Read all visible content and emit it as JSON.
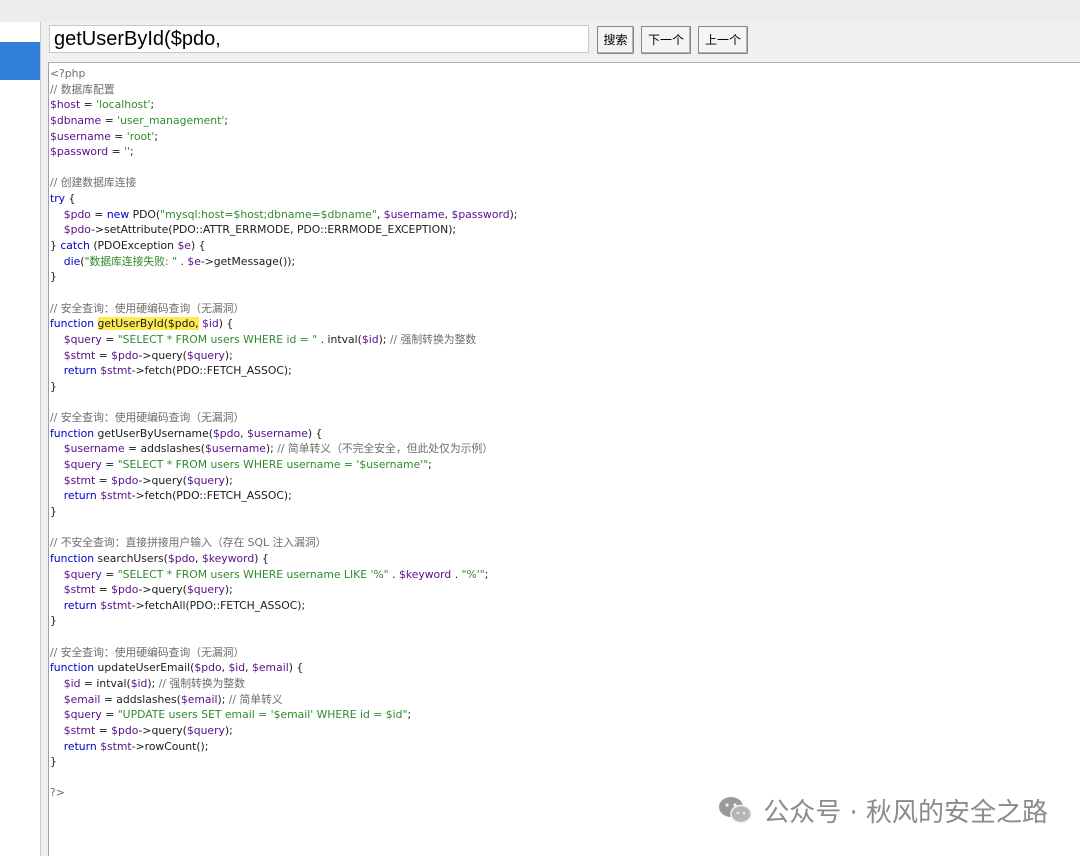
{
  "search": {
    "value": "getUserById($pdo,",
    "buttons": {
      "search": "搜索",
      "next": "下一个",
      "prev": "上一个"
    }
  },
  "code": {
    "lines": [
      [
        {
          "t": "<?php",
          "c": "cm"
        }
      ],
      [
        {
          "t": "// 数据库配置",
          "c": "cm"
        }
      ],
      [
        {
          "t": "$host",
          "c": "var"
        },
        {
          "t": " = "
        },
        {
          "t": "'localhost'",
          "c": "str"
        },
        {
          "t": ";"
        }
      ],
      [
        {
          "t": "$dbname",
          "c": "var"
        },
        {
          "t": " = "
        },
        {
          "t": "'user_management'",
          "c": "str"
        },
        {
          "t": ";"
        }
      ],
      [
        {
          "t": "$username",
          "c": "var"
        },
        {
          "t": " = "
        },
        {
          "t": "'root'",
          "c": "str"
        },
        {
          "t": ";"
        }
      ],
      [
        {
          "t": "$password",
          "c": "var"
        },
        {
          "t": " = "
        },
        {
          "t": "''",
          "c": "str"
        },
        {
          "t": ";"
        }
      ],
      [],
      [
        {
          "t": "// 创建数据库连接",
          "c": "cm"
        }
      ],
      [
        {
          "t": "try",
          "c": "kw"
        },
        {
          "t": " {"
        }
      ],
      [
        {
          "t": "    "
        },
        {
          "t": "$pdo",
          "c": "var"
        },
        {
          "t": " = "
        },
        {
          "t": "new",
          "c": "kw"
        },
        {
          "t": " PDO("
        },
        {
          "t": "\"mysql:host=$host;dbname=$dbname\"",
          "c": "str"
        },
        {
          "t": ", "
        },
        {
          "t": "$username",
          "c": "var"
        },
        {
          "t": ", "
        },
        {
          "t": "$password",
          "c": "var"
        },
        {
          "t": ");"
        }
      ],
      [
        {
          "t": "    "
        },
        {
          "t": "$pdo",
          "c": "var"
        },
        {
          "t": "->setAttribute(PDO::ATTR_ERRMODE, PDO::ERRMODE_EXCEPTION);"
        }
      ],
      [
        {
          "t": "} "
        },
        {
          "t": "catch",
          "c": "kw"
        },
        {
          "t": " (PDOException "
        },
        {
          "t": "$e",
          "c": "var"
        },
        {
          "t": ") {"
        }
      ],
      [
        {
          "t": "    "
        },
        {
          "t": "die",
          "c": "kw"
        },
        {
          "t": "("
        },
        {
          "t": "\"数据库连接失败: \"",
          "c": "str"
        },
        {
          "t": " . "
        },
        {
          "t": "$e",
          "c": "var"
        },
        {
          "t": "->getMessage());"
        }
      ],
      [
        {
          "t": "}"
        }
      ],
      [],
      [
        {
          "t": "// 安全查询：使用硬编码查询（无漏洞）",
          "c": "cm"
        }
      ],
      [
        {
          "t": "function",
          "c": "kw"
        },
        {
          "t": " "
        },
        {
          "t": "getUserById($pdo,",
          "c": "hl"
        },
        {
          "t": " "
        },
        {
          "t": "$id",
          "c": "var"
        },
        {
          "t": ") {"
        }
      ],
      [
        {
          "t": "    "
        },
        {
          "t": "$query",
          "c": "var"
        },
        {
          "t": " = "
        },
        {
          "t": "\"SELECT * FROM users WHERE id = \"",
          "c": "str"
        },
        {
          "t": " . intval("
        },
        {
          "t": "$id",
          "c": "var"
        },
        {
          "t": "); "
        },
        {
          "t": "// 强制转换为整数",
          "c": "cm"
        }
      ],
      [
        {
          "t": "    "
        },
        {
          "t": "$stmt",
          "c": "var"
        },
        {
          "t": " = "
        },
        {
          "t": "$pdo",
          "c": "var"
        },
        {
          "t": "->query("
        },
        {
          "t": "$query",
          "c": "var"
        },
        {
          "t": ");"
        }
      ],
      [
        {
          "t": "    "
        },
        {
          "t": "return",
          "c": "kw"
        },
        {
          "t": " "
        },
        {
          "t": "$stmt",
          "c": "var"
        },
        {
          "t": "->fetch(PDO::FETCH_ASSOC);"
        }
      ],
      [
        {
          "t": "}"
        }
      ],
      [],
      [
        {
          "t": "// 安全查询：使用硬编码查询（无漏洞）",
          "c": "cm"
        }
      ],
      [
        {
          "t": "function",
          "c": "kw"
        },
        {
          "t": " getUserByUsername("
        },
        {
          "t": "$pdo",
          "c": "var"
        },
        {
          "t": ", "
        },
        {
          "t": "$username",
          "c": "var"
        },
        {
          "t": ") {"
        }
      ],
      [
        {
          "t": "    "
        },
        {
          "t": "$username",
          "c": "var"
        },
        {
          "t": " = addslashes("
        },
        {
          "t": "$username",
          "c": "var"
        },
        {
          "t": "); "
        },
        {
          "t": "// 简单转义（不完全安全，但此处仅为示例）",
          "c": "cm"
        }
      ],
      [
        {
          "t": "    "
        },
        {
          "t": "$query",
          "c": "var"
        },
        {
          "t": " = "
        },
        {
          "t": "\"SELECT * FROM users WHERE username = '$username'\"",
          "c": "str"
        },
        {
          "t": ";"
        }
      ],
      [
        {
          "t": "    "
        },
        {
          "t": "$stmt",
          "c": "var"
        },
        {
          "t": " = "
        },
        {
          "t": "$pdo",
          "c": "var"
        },
        {
          "t": "->query("
        },
        {
          "t": "$query",
          "c": "var"
        },
        {
          "t": ");"
        }
      ],
      [
        {
          "t": "    "
        },
        {
          "t": "return",
          "c": "kw"
        },
        {
          "t": " "
        },
        {
          "t": "$stmt",
          "c": "var"
        },
        {
          "t": "->fetch(PDO::FETCH_ASSOC);"
        }
      ],
      [
        {
          "t": "}"
        }
      ],
      [],
      [
        {
          "t": "// 不安全查询：直接拼接用户输入（存在 SQL 注入漏洞）",
          "c": "cm"
        }
      ],
      [
        {
          "t": "function",
          "c": "kw"
        },
        {
          "t": " searchUsers("
        },
        {
          "t": "$pdo",
          "c": "var"
        },
        {
          "t": ", "
        },
        {
          "t": "$keyword",
          "c": "var"
        },
        {
          "t": ") {"
        }
      ],
      [
        {
          "t": "    "
        },
        {
          "t": "$query",
          "c": "var"
        },
        {
          "t": " = "
        },
        {
          "t": "\"SELECT * FROM users WHERE username LIKE '%\"",
          "c": "str"
        },
        {
          "t": " . "
        },
        {
          "t": "$keyword",
          "c": "var"
        },
        {
          "t": " . "
        },
        {
          "t": "\"%'\"",
          "c": "str"
        },
        {
          "t": ";"
        }
      ],
      [
        {
          "t": "    "
        },
        {
          "t": "$stmt",
          "c": "var"
        },
        {
          "t": " = "
        },
        {
          "t": "$pdo",
          "c": "var"
        },
        {
          "t": "->query("
        },
        {
          "t": "$query",
          "c": "var"
        },
        {
          "t": ");"
        }
      ],
      [
        {
          "t": "    "
        },
        {
          "t": "return",
          "c": "kw"
        },
        {
          "t": " "
        },
        {
          "t": "$stmt",
          "c": "var"
        },
        {
          "t": "->fetchAll(PDO::FETCH_ASSOC);"
        }
      ],
      [
        {
          "t": "}"
        }
      ],
      [],
      [
        {
          "t": "// 安全查询：使用硬编码查询（无漏洞）",
          "c": "cm"
        }
      ],
      [
        {
          "t": "function",
          "c": "kw"
        },
        {
          "t": " updateUserEmail("
        },
        {
          "t": "$pdo",
          "c": "var"
        },
        {
          "t": ", "
        },
        {
          "t": "$id",
          "c": "var"
        },
        {
          "t": ", "
        },
        {
          "t": "$email",
          "c": "var"
        },
        {
          "t": ") {"
        }
      ],
      [
        {
          "t": "    "
        },
        {
          "t": "$id",
          "c": "var"
        },
        {
          "t": " = intval("
        },
        {
          "t": "$id",
          "c": "var"
        },
        {
          "t": "); "
        },
        {
          "t": "// 强制转换为整数",
          "c": "cm"
        }
      ],
      [
        {
          "t": "    "
        },
        {
          "t": "$email",
          "c": "var"
        },
        {
          "t": " = addslashes("
        },
        {
          "t": "$email",
          "c": "var"
        },
        {
          "t": "); "
        },
        {
          "t": "// 简单转义",
          "c": "cm"
        }
      ],
      [
        {
          "t": "    "
        },
        {
          "t": "$query",
          "c": "var"
        },
        {
          "t": " = "
        },
        {
          "t": "\"UPDATE users SET email = '$email' WHERE id = $id\"",
          "c": "str"
        },
        {
          "t": ";"
        }
      ],
      [
        {
          "t": "    "
        },
        {
          "t": "$stmt",
          "c": "var"
        },
        {
          "t": " = "
        },
        {
          "t": "$pdo",
          "c": "var"
        },
        {
          "t": "->query("
        },
        {
          "t": "$query",
          "c": "var"
        },
        {
          "t": ");"
        }
      ],
      [
        {
          "t": "    "
        },
        {
          "t": "return",
          "c": "kw"
        },
        {
          "t": " "
        },
        {
          "t": "$stmt",
          "c": "var"
        },
        {
          "t": "->rowCount();"
        }
      ],
      [
        {
          "t": "}"
        }
      ],
      [],
      [
        {
          "t": "?>",
          "c": "cm"
        }
      ]
    ]
  },
  "watermark": {
    "icon": "wechat-icon",
    "text": "公众号 · 秋风的安全之路"
  },
  "colors": {
    "selection": "#2f7fd8",
    "highlight": "#ffea4f",
    "keyword": "#0000cc",
    "variable": "#5a0d8a",
    "string": "#2f8a2f",
    "comment": "#6d6d6d"
  }
}
